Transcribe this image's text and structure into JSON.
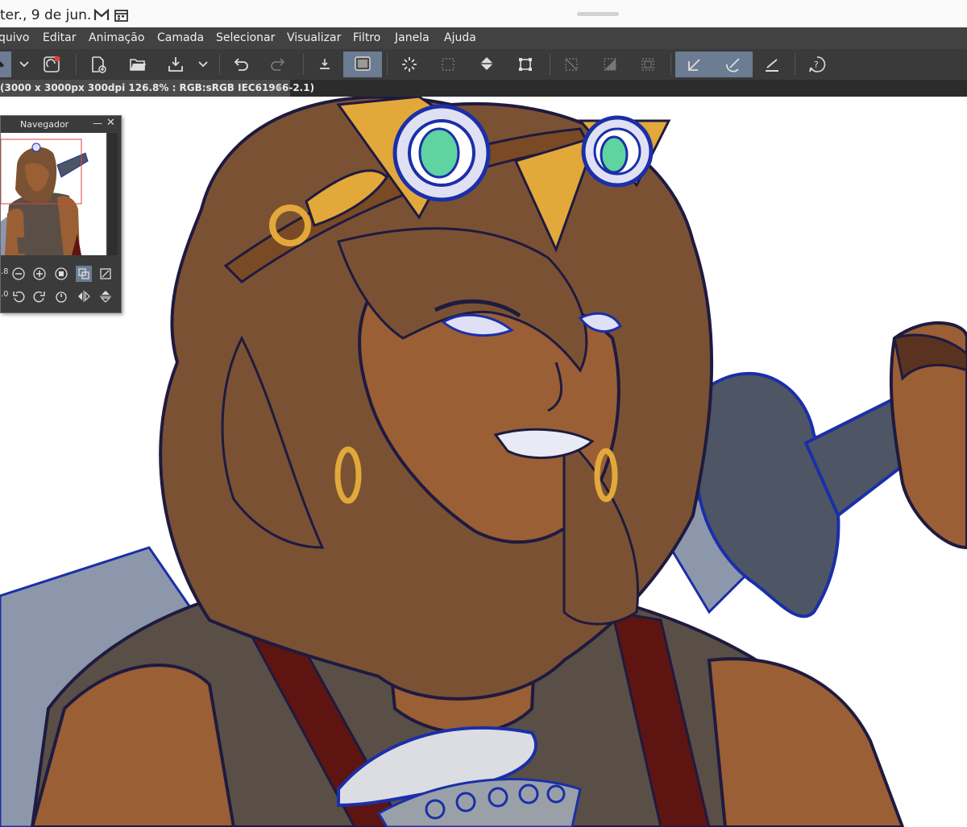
{
  "status_bar": {
    "date": "ter., 9 de jun.",
    "icons": [
      "gmail-icon",
      "calendar-icon"
    ]
  },
  "menu": {
    "items": [
      "quivo",
      "Editar",
      "Animação",
      "Camada",
      "Selecionar",
      "Visualizar",
      "Filtro",
      "Janela",
      "Ajuda"
    ]
  },
  "toolbar": {
    "icons": [
      "pen-dropdown-icon",
      "chevron-down-icon",
      "clip-studio-icon",
      "new-file-icon",
      "open-folder-icon",
      "save-icon",
      "chevron-down-icon",
      "undo-icon",
      "redo-icon",
      "export-icon",
      "show-layer-icon",
      "lasso-select-icon",
      "select-all-icon",
      "fill-icon",
      "transform-icon",
      "deselect-icon",
      "invert-selection-icon",
      "selection-border-icon",
      "pen-stabilizer-icon",
      "brush-stabilizer-icon",
      "ruler-snap-icon",
      "help-icon"
    ],
    "active": [
      "show-layer-icon",
      "pen-stabilizer-icon",
      "brush-stabilizer-icon"
    ],
    "accent_color": "#6b7c93"
  },
  "document": {
    "tab_label": "(3000 x 3000px 300dpi 126.8% : RGB:sRGB IEC61966-2.1)"
  },
  "navigator": {
    "title": "Navegador",
    "zoom_value": ".8",
    "rotation_value": ".0"
  },
  "colors": {
    "menubar": "#424242",
    "toolbar": "#3a3a3a",
    "skin": "#9a5f34",
    "hair": "#7a5233",
    "gold": "#e2a83a",
    "lineart": "#1f1a40"
  }
}
